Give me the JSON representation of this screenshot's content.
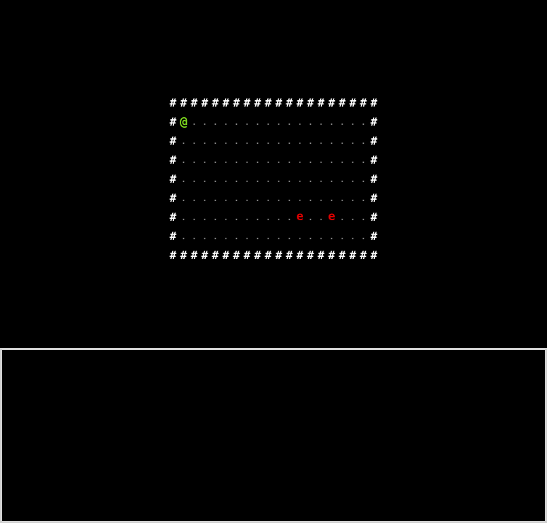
{
  "map": {
    "rows": [
      "####################",
      "#@.................#",
      "#..................#",
      "#..................#",
      "#..................#",
      "#..................#",
      "#...........e..e...#",
      "#..................#",
      "####################"
    ],
    "glyphs": {
      "wall": "#",
      "floor": ".",
      "player": "@",
      "enemy": "e"
    },
    "colors": {
      "background": "#000000",
      "wall": "#ffffff",
      "floor": "#8a8a8a",
      "player": "#7fdc1e",
      "enemy": "#e00000",
      "log_border": "#d0d0d0"
    }
  },
  "message_log": {
    "messages": []
  }
}
